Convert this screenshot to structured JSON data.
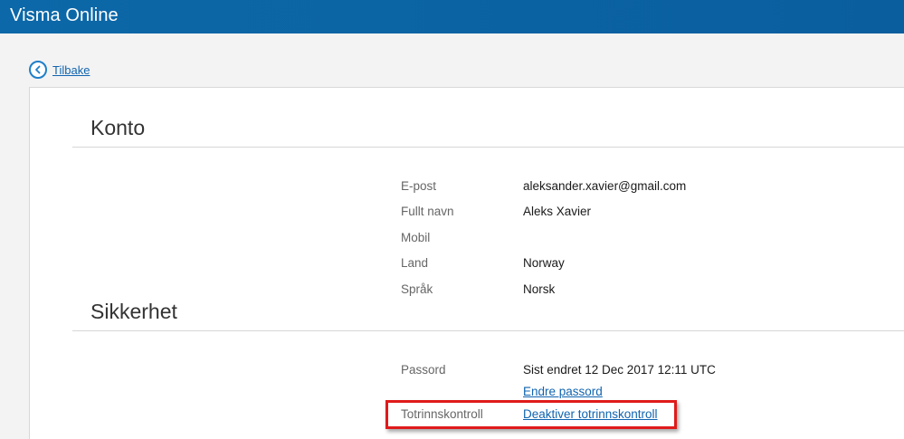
{
  "app": {
    "title": "Visma Online"
  },
  "nav": {
    "back_label": "Tilbake"
  },
  "account": {
    "heading": "Konto",
    "fields": [
      {
        "label": "E-post",
        "value": "aleksander.xavier@gmail.com"
      },
      {
        "label": "Fullt navn",
        "value": "Aleks Xavier"
      },
      {
        "label": "Mobil",
        "value": ""
      },
      {
        "label": "Land",
        "value": "Norway"
      },
      {
        "label": "Språk",
        "value": "Norsk"
      }
    ]
  },
  "security": {
    "heading": "Sikkerhet",
    "password": {
      "label": "Passord",
      "status": "Sist endret 12 Dec 2017 12:11 UTC",
      "change_link": "Endre passord"
    },
    "twofactor": {
      "label": "Totrinnskontroll",
      "action_link": "Deaktiver totrinnskontroll"
    }
  },
  "colors": {
    "header": "#0a64a4",
    "link": "#1064b0",
    "highlight": "#e01a1a"
  }
}
